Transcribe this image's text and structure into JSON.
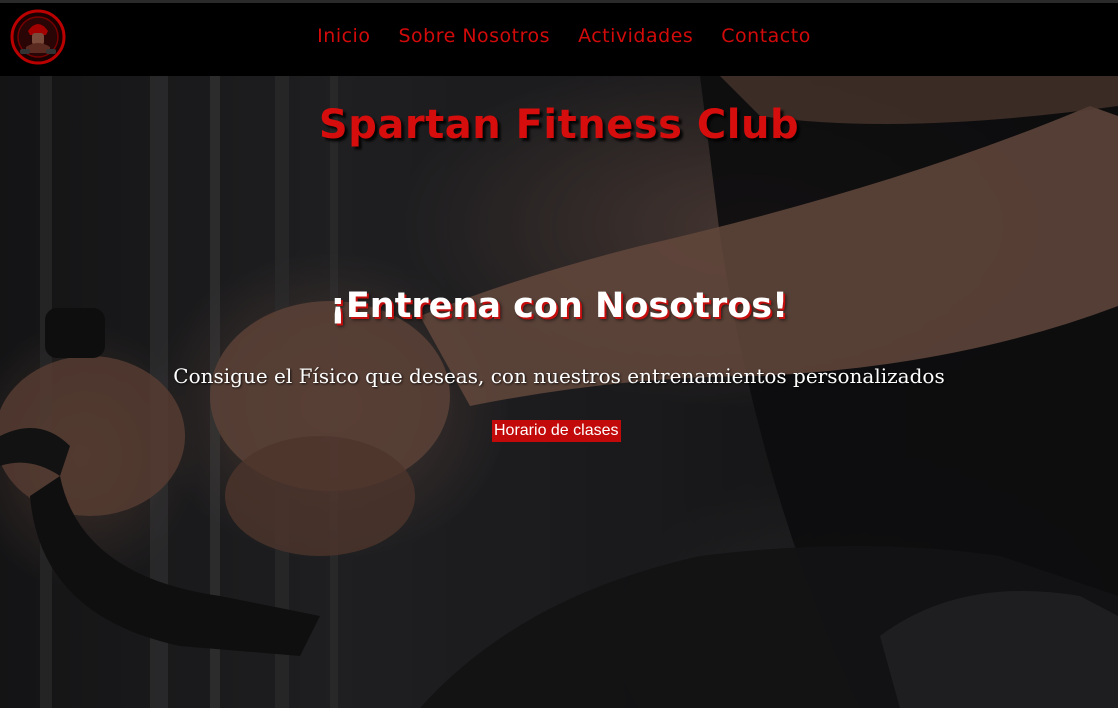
{
  "logo": {
    "icon": "spartan-gym-logo-icon",
    "accent": "#d20a0a"
  },
  "nav": {
    "items": [
      {
        "label": "Inicio"
      },
      {
        "label": "Sobre Nosotros"
      },
      {
        "label": "Actividades"
      },
      {
        "label": "Contacto"
      }
    ]
  },
  "hero": {
    "brand_title": "Spartan Fitness Club",
    "heading": "¡Entrena con Nosotros!",
    "subheading": "Consigue el Físico que deseas, con nuestros entrenamientos personalizados",
    "cta_label": "Horario de clases",
    "background_icon": "gym-workout-photo"
  },
  "colors": {
    "accent": "#d20a0a",
    "nav_background": "#000000",
    "text_light": "#ffffff"
  }
}
